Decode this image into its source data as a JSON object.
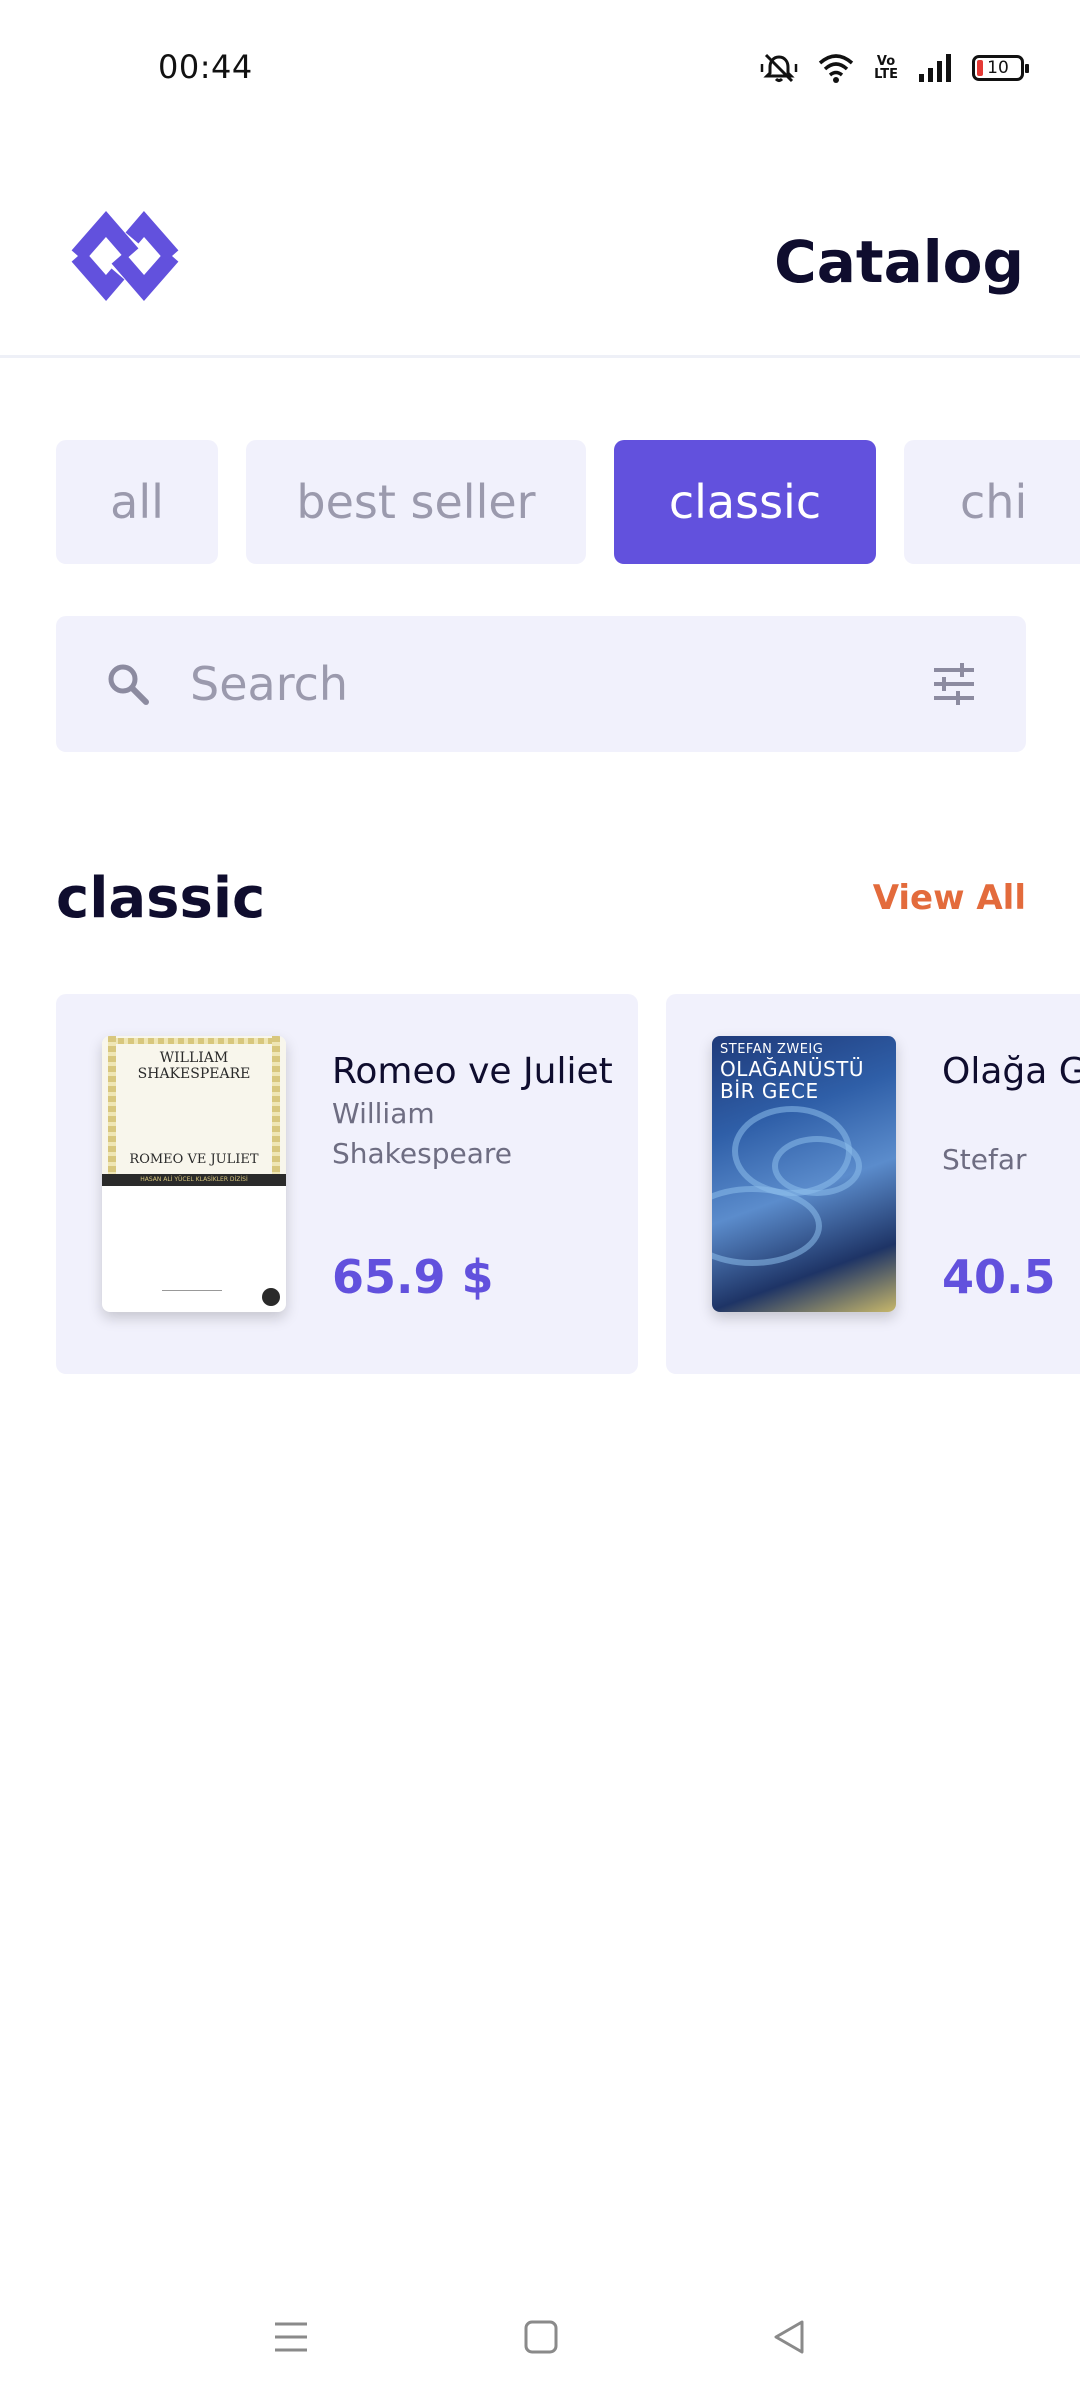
{
  "status_bar": {
    "time": "00:44",
    "battery": "10",
    "volte": "Vo LTE",
    "icons": [
      "mute-icon",
      "wifi-icon",
      "volte-icon",
      "signal-icon",
      "battery-icon"
    ]
  },
  "header": {
    "title": "Catalog",
    "logo": "brand-logo-icon"
  },
  "tabs": [
    {
      "label": "all",
      "active": false
    },
    {
      "label": "best seller",
      "active": false
    },
    {
      "label": "classic",
      "active": true
    },
    {
      "label": "chi",
      "active": false
    }
  ],
  "search": {
    "placeholder": "Search",
    "value": ""
  },
  "section": {
    "title": "classic",
    "view_all": "View All"
  },
  "books": [
    {
      "title": "Romeo ve Juliet",
      "author": "William Shakespeare",
      "price": "65.9 $",
      "cover": {
        "author": "WILLIAM SHAKESPEARE",
        "title": "ROMEO VE JULIET",
        "band": "HASAN ALİ YÜCEL KLASİKLER DİZİSİ"
      }
    },
    {
      "title": "Olağa Gece",
      "author": "Stefar",
      "price": "40.5",
      "cover": {
        "author": "STEFAN ZWEIG",
        "title": "OLAĞANÜSTÜ BİR GECE"
      }
    }
  ],
  "colors": {
    "accent": "#6251dd",
    "link": "#e36b3c",
    "chip_bg": "#f1f1fc",
    "muted_text": "#9b9aad",
    "heading": "#0f0d2e"
  }
}
